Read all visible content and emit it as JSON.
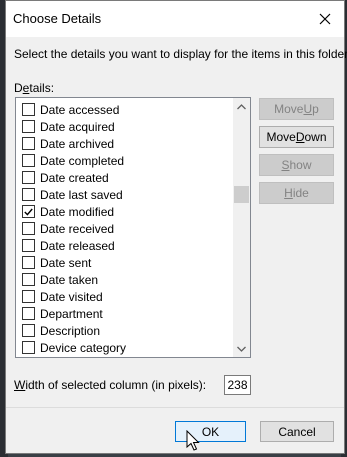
{
  "dialog": {
    "title": "Choose Details",
    "instruction": "Select the details you want to display for the items in this folder.",
    "details_label_prefix": "D",
    "details_label_accel": "e",
    "details_label_rest": "tails:"
  },
  "items": [
    {
      "label": "Date accessed",
      "checked": false
    },
    {
      "label": "Date acquired",
      "checked": false
    },
    {
      "label": "Date archived",
      "checked": false
    },
    {
      "label": "Date completed",
      "checked": false
    },
    {
      "label": "Date created",
      "checked": false
    },
    {
      "label": "Date last saved",
      "checked": false
    },
    {
      "label": "Date modified",
      "checked": true
    },
    {
      "label": "Date received",
      "checked": false
    },
    {
      "label": "Date released",
      "checked": false
    },
    {
      "label": "Date sent",
      "checked": false
    },
    {
      "label": "Date taken",
      "checked": false
    },
    {
      "label": "Date visited",
      "checked": false
    },
    {
      "label": "Department",
      "checked": false
    },
    {
      "label": "Description",
      "checked": false
    },
    {
      "label": "Device category",
      "checked": false
    }
  ],
  "scrollbar": {
    "position_fraction": 0.34
  },
  "buttons": {
    "move_up": {
      "pre": "Move ",
      "accel": "U",
      "post": "p",
      "enabled": false
    },
    "move_down": {
      "pre": "Move ",
      "accel": "D",
      "post": "own",
      "enabled": true
    },
    "show": {
      "pre": "",
      "accel": "S",
      "post": "how",
      "enabled": false
    },
    "hide": {
      "pre": "",
      "accel": "H",
      "post": "ide",
      "enabled": false
    }
  },
  "width": {
    "label_pre": "",
    "label_accel": "W",
    "label_post": "idth of selected column (in pixels):",
    "value": "238"
  },
  "footer": {
    "ok_label": "OK",
    "cancel_label": "Cancel"
  }
}
